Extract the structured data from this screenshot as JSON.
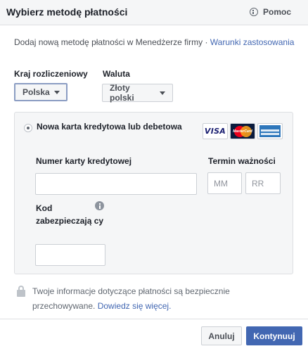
{
  "dialog": {
    "title": "Wybierz metodę płatności",
    "help_label": "Pomoc"
  },
  "intro": {
    "text": "Dodaj nową metodę płatności w Menedżerze firmy · ",
    "link": "Warunki zastosowania"
  },
  "billing": {
    "country_label": "Kraj rozliczeniowy",
    "country_value": "Polska",
    "currency_label": "Waluta",
    "currency_value": "Złoty polski"
  },
  "card_option": {
    "label": "Nowa karta kredytowa lub debetowa",
    "logos": [
      "VISA",
      "MasterCard",
      "American Express"
    ]
  },
  "card_form": {
    "card_number_label": "Numer karty kredytowej",
    "card_number_value": "",
    "expiry_label": "Termin ważności",
    "month_placeholder": "MM",
    "year_placeholder": "RR",
    "cvv_label": "Kod zabezpieczają cy",
    "cvv_value": ""
  },
  "security_note": {
    "text": "Twoje informacje dotyczące płatności są bezpiecznie przechowywane. ",
    "link": "Dowiedz się więcej."
  },
  "footer": {
    "cancel_label": "Anuluj",
    "continue_label": "Kontynuuj"
  },
  "colors": {
    "brand_blue": "#4267b2",
    "panel_bg": "#f5f6f7",
    "border": "#dddfe2"
  }
}
